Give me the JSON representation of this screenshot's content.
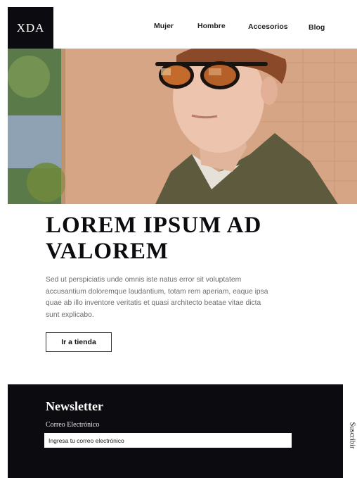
{
  "brand": {
    "logo_text": "XDA"
  },
  "nav": {
    "items": [
      "Mujer",
      "Hombre",
      "Accesorios",
      "Blog"
    ]
  },
  "hero": {
    "headline": "LOREM IPSUM AD VALOREM",
    "body": "Sed ut perspiciatis unde omnis iste natus error sit voluptatem accusantium doloremque laudantium, totam rem aperiam, eaque ipsa quae ab illo inventore veritatis et quasi architecto beatae vitae dicta sunt explicabo.",
    "cta_label": "Ir a tienda"
  },
  "newsletter": {
    "title": "Newsletter",
    "email_label": "Correo Electrónico",
    "email_placeholder": "Ingresa tu correo electrónico",
    "email_value": "",
    "subscribe_label": "Suscribir"
  },
  "colors": {
    "dark": "#0c0b10",
    "text_muted": "#6b6b6b",
    "white": "#ffffff"
  }
}
